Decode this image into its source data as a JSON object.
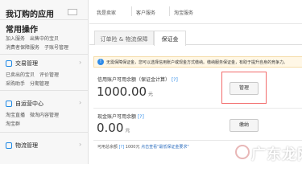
{
  "sidebar": {
    "title": "我订购的应用",
    "common_ops_title": "常用操作",
    "common_ops_rows": [
      [
        "加入服务",
        "出售中的宝贝"
      ],
      [
        "消费者保障服务",
        "子账号管理"
      ]
    ],
    "groups": [
      {
        "label": "交易管理",
        "links": [
          [
            "已卖出的宝贝",
            "评价管理"
          ],
          [
            "采购助手",
            "分期管理"
          ]
        ]
      },
      {
        "label": "自运营中心",
        "links": [
          [
            "淘宝直播",
            "微淘内容管理"
          ],
          [
            "淘宝群"
          ]
        ]
      },
      {
        "label": "物流管理",
        "links": []
      }
    ]
  },
  "breadcrumb": [
    "我是卖家",
    "客户服务",
    "淘宝服务"
  ],
  "tabs": [
    "订单险 & 物流保障",
    "保证金"
  ],
  "notice": {
    "icon": "!",
    "text": "无需保障保证金，您可以选择信用账户或现金方式缴纳。缴纳服务保证金，有助于提升自身的竞争力。"
  },
  "credit": {
    "label": "信用账户可用余额（保证金计算）",
    "help": "[?]",
    "amount": "1000.00",
    "unit": "元",
    "button": "管理"
  },
  "cash": {
    "label": "现金账户可用余额",
    "help": "[?]",
    "amount": "0.00",
    "unit": "元",
    "button": "缴纳"
  },
  "footer": {
    "prefix": "可用总余额",
    "help": "[?]",
    "amount": "1000元",
    "link": "点击查看\"最低保证金要求\""
  },
  "watermark": {
    "text": "广东龙网"
  },
  "colors": {
    "accent": "#2f8be8",
    "highlight": "#f26b6b",
    "notice_bg": "#fff7e6"
  }
}
